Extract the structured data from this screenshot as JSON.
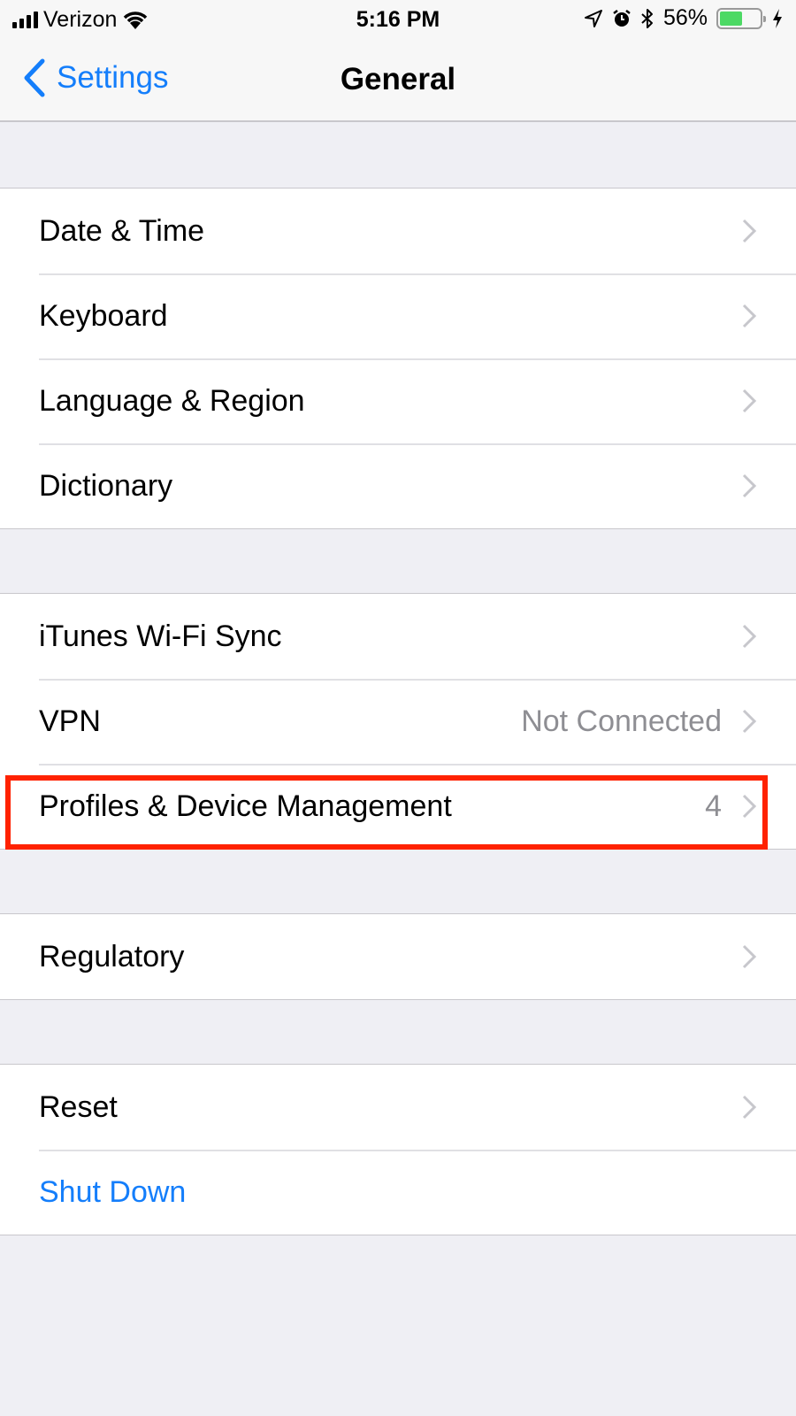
{
  "status_bar": {
    "carrier": "Verizon",
    "time": "5:16 PM",
    "battery_percent_label": "56%",
    "battery_level": 0.56,
    "icons": [
      "signal-icon",
      "wifi-icon",
      "location-icon",
      "alarm-icon",
      "bluetooth-icon",
      "battery-icon",
      "charging-icon"
    ]
  },
  "nav": {
    "back_label": "Settings",
    "title": "General"
  },
  "groups": [
    {
      "rows": [
        {
          "label": "Date & Time"
        },
        {
          "label": "Keyboard"
        },
        {
          "label": "Language & Region"
        },
        {
          "label": "Dictionary"
        }
      ]
    },
    {
      "rows": [
        {
          "label": "iTunes Wi-Fi Sync"
        },
        {
          "label": "VPN",
          "value": "Not Connected"
        },
        {
          "label": "Profiles & Device Management",
          "value": "4",
          "highlighted": true
        }
      ]
    },
    {
      "rows": [
        {
          "label": "Regulatory"
        }
      ]
    },
    {
      "rows": [
        {
          "label": "Reset"
        },
        {
          "label": "Shut Down",
          "action": true
        }
      ]
    }
  ],
  "colors": {
    "accent": "#147efb",
    "highlight_box": "#ff2200",
    "battery_fill": "#4cd964",
    "background": "#efeff4"
  }
}
